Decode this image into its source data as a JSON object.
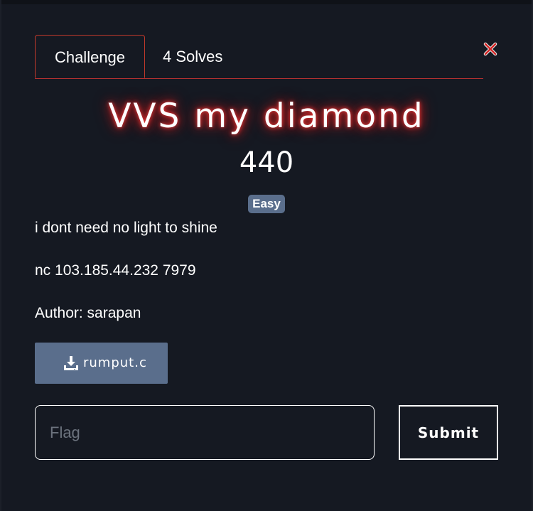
{
  "tabs": [
    {
      "label": "Challenge",
      "active": true
    },
    {
      "label": "4 Solves",
      "active": false
    }
  ],
  "challenge": {
    "name": "VVS my diamond",
    "points": "440",
    "difficulty": "Easy",
    "description": [
      "i dont need no light to shine",
      "nc 103.185.44.232 7979",
      "Author: sarapan"
    ],
    "file": {
      "name": "rumput.c",
      "icon": "download-icon"
    }
  },
  "form": {
    "flag_placeholder": "Flag",
    "flag_value": "",
    "submit_label": "Submit"
  },
  "colors": {
    "background": "#151922",
    "accent_red": "#c0392b",
    "badge_bg": "#5a6e8c",
    "button_bg": "#5a6e8c",
    "title_glow": "#ff3b3b"
  }
}
